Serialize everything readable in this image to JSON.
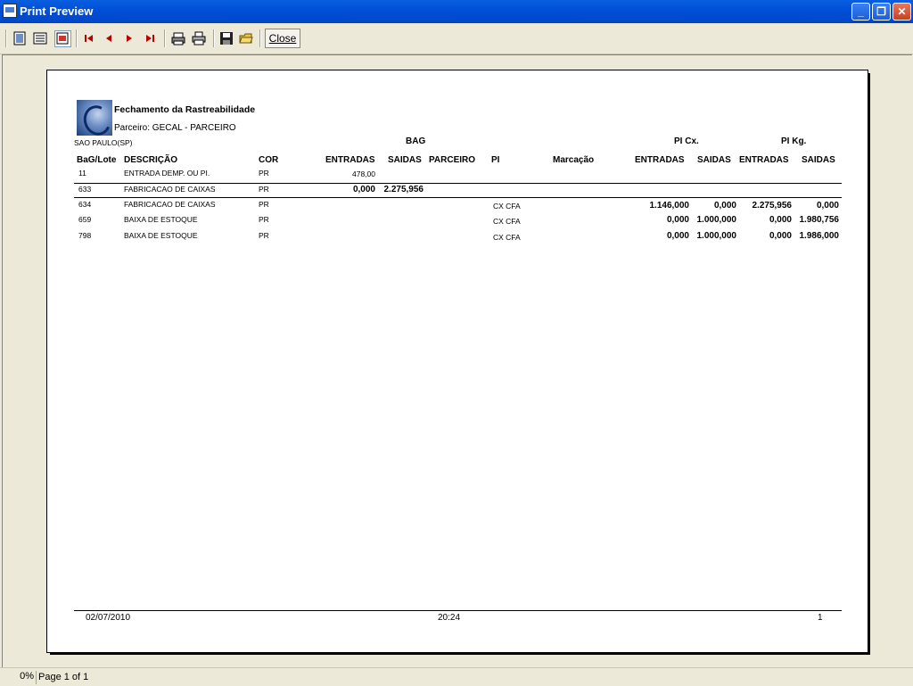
{
  "window": {
    "title": "Print Preview"
  },
  "toolbar": {
    "close_label": "Close"
  },
  "report": {
    "title": "Fechamento da Rastreabilidade",
    "parceiro": "Parceiro: GECAL - PARCEIRO",
    "location": "SAO PAULO(SP)",
    "groups": {
      "bag": "BAG",
      "pi_cx": "PI Cx.",
      "pi_kg": "PI Kg."
    },
    "columns": {
      "bag_lote": "BaG/Lote",
      "descricao": "DESCRIÇÃO",
      "cor": "COR",
      "entradas": "ENTRADAS",
      "saidas": "SAIDAS",
      "parceiro": "PARCEIRO",
      "pi": "PI",
      "marcacao": "Marcação",
      "cx_entradas": "ENTRADAS",
      "cx_saidas": "SAIDAS",
      "kg_entradas": "ENTRADAS",
      "kg_saidas": "SAIDAS"
    },
    "rows": [
      {
        "lote": "11",
        "desc": "ENTRADA DEMP. OU PI.",
        "cor": "PR",
        "entradas": "478,00",
        "saidas": "",
        "pi": "",
        "cx_ent": "",
        "cx_sai": "",
        "kg_ent": "",
        "kg_sai": ""
      },
      {
        "lote": "633",
        "desc": "FABRICACAO DE CAIXAS",
        "cor": "PR",
        "entradas": "0,000",
        "saidas": "2.275,956",
        "pi": "",
        "cx_ent": "",
        "cx_sai": "",
        "kg_ent": "",
        "kg_sai": ""
      },
      {
        "lote": "634",
        "desc": "FABRICACAO DE CAIXAS",
        "cor": "PR",
        "entradas": "",
        "saidas": "",
        "pi": "CX CFA",
        "cx_ent": "1.146,000",
        "cx_sai": "0,000",
        "kg_ent": "2.275,956",
        "kg_sai": "0,000"
      },
      {
        "lote": "659",
        "desc": "BAIXA DE ESTOQUE",
        "cor": "PR",
        "entradas": "",
        "saidas": "",
        "pi": "CX CFA",
        "cx_ent": "0,000",
        "cx_sai": "1.000,000",
        "kg_ent": "0,000",
        "kg_sai": "1.980,756"
      },
      {
        "lote": "798",
        "desc": "BAIXA DE ESTOQUE",
        "cor": "PR",
        "entradas": "",
        "saidas": "",
        "pi": "CX CFA",
        "cx_ent": "0,000",
        "cx_sai": "1.000,000",
        "kg_ent": "0,000",
        "kg_sai": "1.986,000"
      }
    ],
    "footer": {
      "date": "02/07/2010",
      "time": "20:24",
      "page": "1"
    }
  },
  "status": {
    "zoom": "0%",
    "page_info": "Page 1 of 1"
  }
}
